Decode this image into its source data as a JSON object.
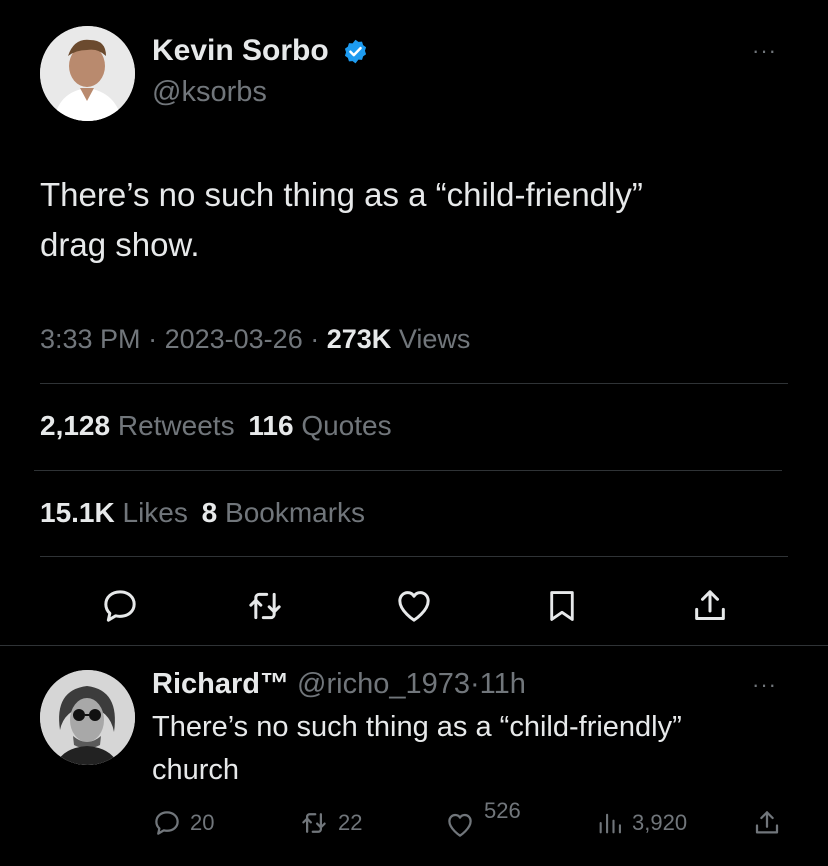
{
  "tweet": {
    "author_name": "Kevin Sorbo",
    "author_handle": "@ksorbs",
    "text_line1": "There’s no such thing as a “child-friendly”",
    "text_line2": "drag show.",
    "time": "3:33 PM",
    "sep1": "·",
    "date": "2023-03-26",
    "sep2": "·",
    "views_count": "273K",
    "views_label": "Views",
    "retweets_count": "2,128",
    "retweets_label": "Retweets",
    "quotes_count": "116",
    "quotes_label": "Quotes",
    "likes_count": "15.1K",
    "likes_label": "Likes",
    "bookmarks_count": "8",
    "bookmarks_label": "Bookmarks",
    "more": "···"
  },
  "reply": {
    "author_name": "Richard™",
    "author_handle": "@richo_1973",
    "sep": "·",
    "time": "11h",
    "text_line1": "There’s no such thing as a “child-friendly”",
    "text_line2": "church",
    "reply_count": "20",
    "retweet_count": "22",
    "like_count": "526",
    "views_count": "3,920",
    "more": "···"
  },
  "colors": {
    "background": "#000000",
    "text": "#e7e9ea",
    "muted": "#71767b",
    "verified": "#1d9bf0",
    "divider": "#2f3336"
  },
  "icons": {
    "verified": "verified-badge-icon",
    "reply": "reply-icon",
    "retweet": "retweet-icon",
    "like": "heart-icon",
    "bookmark": "bookmark-icon",
    "share": "share-icon",
    "views": "views-icon",
    "more": "more-icon"
  }
}
